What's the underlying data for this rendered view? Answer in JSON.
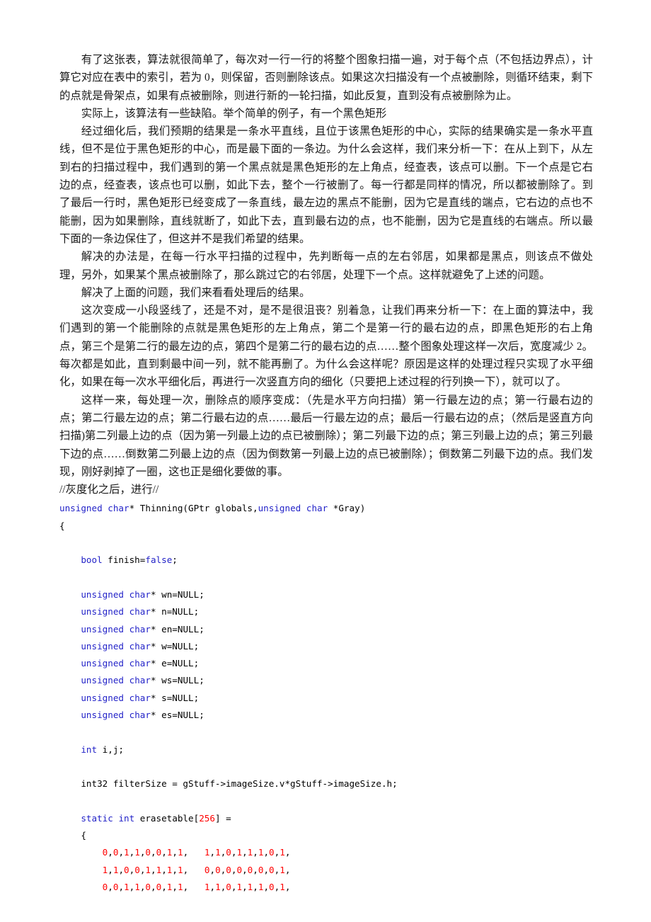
{
  "document": {
    "paragraphs": [
      "有了这张表，算法就很简单了，每次对一行一行的将整个图象扫描一遍，对于每个点（不包括边界点），计算它对应在表中的索引，若为 0，则保留，否则删除该点。如果这次扫描没有一个点被删除，则循环结束，剩下的点就是骨架点，如果有点被删除，则进行新的一轮扫描，如此反复，直到没有点被删除为止。",
      "实际上，该算法有一些缺陷。举个简单的例子，有一个黑色矩形",
      "经过细化后，我们预期的结果是一条水平直线，且位于该黑色矩形的中心，实际的结果确实是一条水平直线，但不是位于黑色矩形的中心，而是最下面的一条边。为什么会这样，我们来分析一下：在从上到下，从左到右的扫描过程中，我们遇到的第一个黑点就是黑色矩形的左上角点，经查表，该点可以删。下一个点是它右边的点，经查表，该点也可以删，如此下去，整个一行被删了。每一行都是同样的情况，所以都被删除了。到了最后一行时，黑色矩形已经变成了一条直线，最左边的黑点不能删，因为它是直线的端点，它右边的点也不能删，因为如果删除，直线就断了，如此下去，直到最右边的点，也不能删，因为它是直线的右端点。所以最下面的一条边保住了，但这并不是我们希望的结果。",
      "解决的办法是，在每一行水平扫描的过程中，先判断每一点的左右邻居，如果都是黑点，则该点不做处理，另外，如果某个黑点被删除了，那么跳过它的右邻居，处理下一个点。这样就避免了上述的问题。",
      "解决了上面的问题，我们来看看处理后的结果。",
      "这次变成一小段竖线了，还是不对，是不是很沮丧？别着急，让我们再来分析一下：在上面的算法中，我们遇到的第一个能删除的点就是黑色矩形的左上角点，第二个是第一行的最右边的点，即黑色矩形的右上角点，第三个是第二行的最左边的点，第四个是第二行的最右边的点……整个图象处理这样一次后，宽度减少 2。每次都是如此，直到剩最中间一列，就不能再删了。为什么会这样呢？原因是这样的处理过程只实现了水平细化，如果在每一次水平细化后，再进行一次竖直方向的细化（只要把上述过程的行列换一下），就可以了。",
      "这样一来，每处理一次，删除点的顺序变成：（先是水平方向扫描）第一行最左边的点；第一行最右边的点；第二行最左边的点；第二行最右边的点……最后一行最左边的点；最后一行最右边的点；（然后是竖直方向扫描)第二列最上边的点（因为第一列最上边的点已被删除）；第二列最下边的点；第三列最上边的点；第三列最下边的点……倒数第二列最上边的点（因为倒数第一列最上边的点已被删除）；倒数第二列最下边的点。我们发现，刚好剥掉了一圈，这也正是细化要做的事。"
    ],
    "comment_line": "//灰度化之后，进行//",
    "colors": {
      "keyword": "#2323c8",
      "number": "#ff0000",
      "text": "#1a1a1a",
      "background": "#ffffff"
    },
    "code_lines": [
      {
        "indent": 0,
        "tokens": [
          {
            "t": "unsigned",
            "c": "kw"
          },
          {
            "t": " ",
            "c": "pun"
          },
          {
            "t": "char",
            "c": "kw"
          },
          {
            "t": "* Thinning(GPtr globals,",
            "c": "pun"
          },
          {
            "t": "unsigned",
            "c": "kw"
          },
          {
            "t": " ",
            "c": "pun"
          },
          {
            "t": "char",
            "c": "kw"
          },
          {
            "t": " *Gray)",
            "c": "pun"
          }
        ]
      },
      {
        "indent": 0,
        "tokens": [
          {
            "t": "{",
            "c": "pun"
          }
        ]
      },
      {
        "indent": 0,
        "tokens": []
      },
      {
        "indent": 1,
        "tokens": [
          {
            "t": "bool",
            "c": "kw"
          },
          {
            "t": " finish=",
            "c": "pun"
          },
          {
            "t": "false",
            "c": "kw"
          },
          {
            "t": ";",
            "c": "pun"
          }
        ]
      },
      {
        "indent": 0,
        "tokens": []
      },
      {
        "indent": 1,
        "tokens": [
          {
            "t": "unsigned",
            "c": "kw"
          },
          {
            "t": " ",
            "c": "pun"
          },
          {
            "t": "char",
            "c": "kw"
          },
          {
            "t": "* wn=NULL;",
            "c": "pun"
          }
        ]
      },
      {
        "indent": 1,
        "tokens": [
          {
            "t": "unsigned",
            "c": "kw"
          },
          {
            "t": " ",
            "c": "pun"
          },
          {
            "t": "char",
            "c": "kw"
          },
          {
            "t": "* n=NULL;",
            "c": "pun"
          }
        ]
      },
      {
        "indent": 1,
        "tokens": [
          {
            "t": "unsigned",
            "c": "kw"
          },
          {
            "t": " ",
            "c": "pun"
          },
          {
            "t": "char",
            "c": "kw"
          },
          {
            "t": "* en=NULL;",
            "c": "pun"
          }
        ]
      },
      {
        "indent": 1,
        "tokens": [
          {
            "t": "unsigned",
            "c": "kw"
          },
          {
            "t": " ",
            "c": "pun"
          },
          {
            "t": "char",
            "c": "kw"
          },
          {
            "t": "* w=NULL;",
            "c": "pun"
          }
        ]
      },
      {
        "indent": 1,
        "tokens": [
          {
            "t": "unsigned",
            "c": "kw"
          },
          {
            "t": " ",
            "c": "pun"
          },
          {
            "t": "char",
            "c": "kw"
          },
          {
            "t": "* e=NULL;",
            "c": "pun"
          }
        ]
      },
      {
        "indent": 1,
        "tokens": [
          {
            "t": "unsigned",
            "c": "kw"
          },
          {
            "t": " ",
            "c": "pun"
          },
          {
            "t": "char",
            "c": "kw"
          },
          {
            "t": "* ws=NULL;",
            "c": "pun"
          }
        ]
      },
      {
        "indent": 1,
        "tokens": [
          {
            "t": "unsigned",
            "c": "kw"
          },
          {
            "t": " ",
            "c": "pun"
          },
          {
            "t": "char",
            "c": "kw"
          },
          {
            "t": "* s=NULL;",
            "c": "pun"
          }
        ]
      },
      {
        "indent": 1,
        "tokens": [
          {
            "t": "unsigned",
            "c": "kw"
          },
          {
            "t": " ",
            "c": "pun"
          },
          {
            "t": "char",
            "c": "kw"
          },
          {
            "t": "* es=NULL;",
            "c": "pun"
          }
        ]
      },
      {
        "indent": 0,
        "tokens": []
      },
      {
        "indent": 1,
        "tokens": [
          {
            "t": "int",
            "c": "kw"
          },
          {
            "t": " i,j;",
            "c": "pun"
          }
        ]
      },
      {
        "indent": 0,
        "tokens": []
      },
      {
        "indent": 1,
        "tokens": [
          {
            "t": "int32 filterSize = gStuff->imageSize.v*gStuff->imageSize.h;",
            "c": "pun"
          }
        ]
      },
      {
        "indent": 0,
        "tokens": []
      },
      {
        "indent": 1,
        "tokens": [
          {
            "t": "static",
            "c": "kw"
          },
          {
            "t": " ",
            "c": "pun"
          },
          {
            "t": "int",
            "c": "kw"
          },
          {
            "t": " erasetable[",
            "c": "pun"
          },
          {
            "t": "256",
            "c": "num"
          },
          {
            "t": "] =",
            "c": "pun"
          }
        ]
      },
      {
        "indent": 1,
        "tokens": [
          {
            "t": "{",
            "c": "pun"
          }
        ]
      },
      {
        "indent": 2,
        "tokens": [
          {
            "t": "0",
            "c": "num"
          },
          {
            "t": ",",
            "c": "pun"
          },
          {
            "t": "0",
            "c": "num"
          },
          {
            "t": ",",
            "c": "pun"
          },
          {
            "t": "1",
            "c": "num"
          },
          {
            "t": ",",
            "c": "pun"
          },
          {
            "t": "1",
            "c": "num"
          },
          {
            "t": ",",
            "c": "pun"
          },
          {
            "t": "0",
            "c": "num"
          },
          {
            "t": ",",
            "c": "pun"
          },
          {
            "t": "0",
            "c": "num"
          },
          {
            "t": ",",
            "c": "pun"
          },
          {
            "t": "1",
            "c": "num"
          },
          {
            "t": ",",
            "c": "pun"
          },
          {
            "t": "1",
            "c": "num"
          },
          {
            "t": ",   ",
            "c": "pun"
          },
          {
            "t": "1",
            "c": "num"
          },
          {
            "t": ",",
            "c": "pun"
          },
          {
            "t": "1",
            "c": "num"
          },
          {
            "t": ",",
            "c": "pun"
          },
          {
            "t": "0",
            "c": "num"
          },
          {
            "t": ",",
            "c": "pun"
          },
          {
            "t": "1",
            "c": "num"
          },
          {
            "t": ",",
            "c": "pun"
          },
          {
            "t": "1",
            "c": "num"
          },
          {
            "t": ",",
            "c": "pun"
          },
          {
            "t": "1",
            "c": "num"
          },
          {
            "t": ",",
            "c": "pun"
          },
          {
            "t": "0",
            "c": "num"
          },
          {
            "t": ",",
            "c": "pun"
          },
          {
            "t": "1",
            "c": "num"
          },
          {
            "t": ",",
            "c": "pun"
          }
        ]
      },
      {
        "indent": 2,
        "tokens": [
          {
            "t": "1",
            "c": "num"
          },
          {
            "t": ",",
            "c": "pun"
          },
          {
            "t": "1",
            "c": "num"
          },
          {
            "t": ",",
            "c": "pun"
          },
          {
            "t": "0",
            "c": "num"
          },
          {
            "t": ",",
            "c": "pun"
          },
          {
            "t": "0",
            "c": "num"
          },
          {
            "t": ",",
            "c": "pun"
          },
          {
            "t": "1",
            "c": "num"
          },
          {
            "t": ",",
            "c": "pun"
          },
          {
            "t": "1",
            "c": "num"
          },
          {
            "t": ",",
            "c": "pun"
          },
          {
            "t": "1",
            "c": "num"
          },
          {
            "t": ",",
            "c": "pun"
          },
          {
            "t": "1",
            "c": "num"
          },
          {
            "t": ",   ",
            "c": "pun"
          },
          {
            "t": "0",
            "c": "num"
          },
          {
            "t": ",",
            "c": "pun"
          },
          {
            "t": "0",
            "c": "num"
          },
          {
            "t": ",",
            "c": "pun"
          },
          {
            "t": "0",
            "c": "num"
          },
          {
            "t": ",",
            "c": "pun"
          },
          {
            "t": "0",
            "c": "num"
          },
          {
            "t": ",",
            "c": "pun"
          },
          {
            "t": "0",
            "c": "num"
          },
          {
            "t": ",",
            "c": "pun"
          },
          {
            "t": "0",
            "c": "num"
          },
          {
            "t": ",",
            "c": "pun"
          },
          {
            "t": "0",
            "c": "num"
          },
          {
            "t": ",",
            "c": "pun"
          },
          {
            "t": "1",
            "c": "num"
          },
          {
            "t": ",",
            "c": "pun"
          }
        ]
      },
      {
        "indent": 2,
        "tokens": [
          {
            "t": "0",
            "c": "num"
          },
          {
            "t": ",",
            "c": "pun"
          },
          {
            "t": "0",
            "c": "num"
          },
          {
            "t": ",",
            "c": "pun"
          },
          {
            "t": "1",
            "c": "num"
          },
          {
            "t": ",",
            "c": "pun"
          },
          {
            "t": "1",
            "c": "num"
          },
          {
            "t": ",",
            "c": "pun"
          },
          {
            "t": "0",
            "c": "num"
          },
          {
            "t": ",",
            "c": "pun"
          },
          {
            "t": "0",
            "c": "num"
          },
          {
            "t": ",",
            "c": "pun"
          },
          {
            "t": "1",
            "c": "num"
          },
          {
            "t": ",",
            "c": "pun"
          },
          {
            "t": "1",
            "c": "num"
          },
          {
            "t": ",   ",
            "c": "pun"
          },
          {
            "t": "1",
            "c": "num"
          },
          {
            "t": ",",
            "c": "pun"
          },
          {
            "t": "1",
            "c": "num"
          },
          {
            "t": ",",
            "c": "pun"
          },
          {
            "t": "0",
            "c": "num"
          },
          {
            "t": ",",
            "c": "pun"
          },
          {
            "t": "1",
            "c": "num"
          },
          {
            "t": ",",
            "c": "pun"
          },
          {
            "t": "1",
            "c": "num"
          },
          {
            "t": ",",
            "c": "pun"
          },
          {
            "t": "1",
            "c": "num"
          },
          {
            "t": ",",
            "c": "pun"
          },
          {
            "t": "0",
            "c": "num"
          },
          {
            "t": ",",
            "c": "pun"
          },
          {
            "t": "1",
            "c": "num"
          },
          {
            "t": ",",
            "c": "pun"
          }
        ]
      }
    ]
  }
}
